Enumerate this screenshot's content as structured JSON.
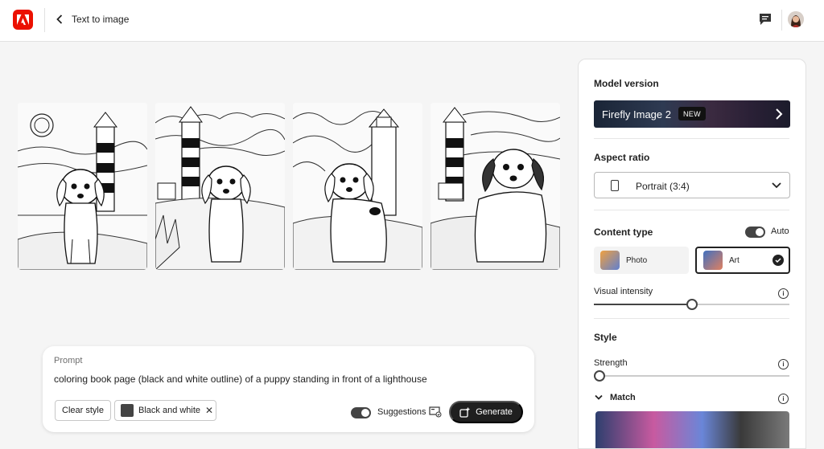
{
  "header": {
    "title": "Text to image",
    "colors": {
      "brand": "#eb1000"
    }
  },
  "images": [
    {
      "alt": "puppy and lighthouse coloring page 1"
    },
    {
      "alt": "puppy and lighthouse coloring page 2"
    },
    {
      "alt": "puppy and lighthouse coloring page 3"
    },
    {
      "alt": "puppy and lighthouse coloring page 4"
    }
  ],
  "prompt": {
    "label": "Prompt",
    "text": "coloring book page (black and white outline) of a puppy standing in front of a lighthouse",
    "clear_style": "Clear style",
    "chip_label": "Black and white",
    "suggestions_label": "Suggestions",
    "suggestions_on": true,
    "generate_label": "Generate"
  },
  "panel": {
    "model_version": {
      "title": "Model version",
      "model_name": "Firefly Image 2",
      "badge": "NEW"
    },
    "aspect_ratio": {
      "title": "Aspect ratio",
      "value": "Portrait (3:4)"
    },
    "content_type": {
      "title": "Content type",
      "auto_label": "Auto",
      "auto_on": true,
      "options": [
        "Photo",
        "Art"
      ],
      "selected": "Art"
    },
    "visual_intensity": {
      "label": "Visual intensity",
      "value": 0.5
    },
    "style": {
      "title": "Style",
      "strength_label": "Strength",
      "strength_value": 0,
      "match_label": "Match"
    }
  }
}
